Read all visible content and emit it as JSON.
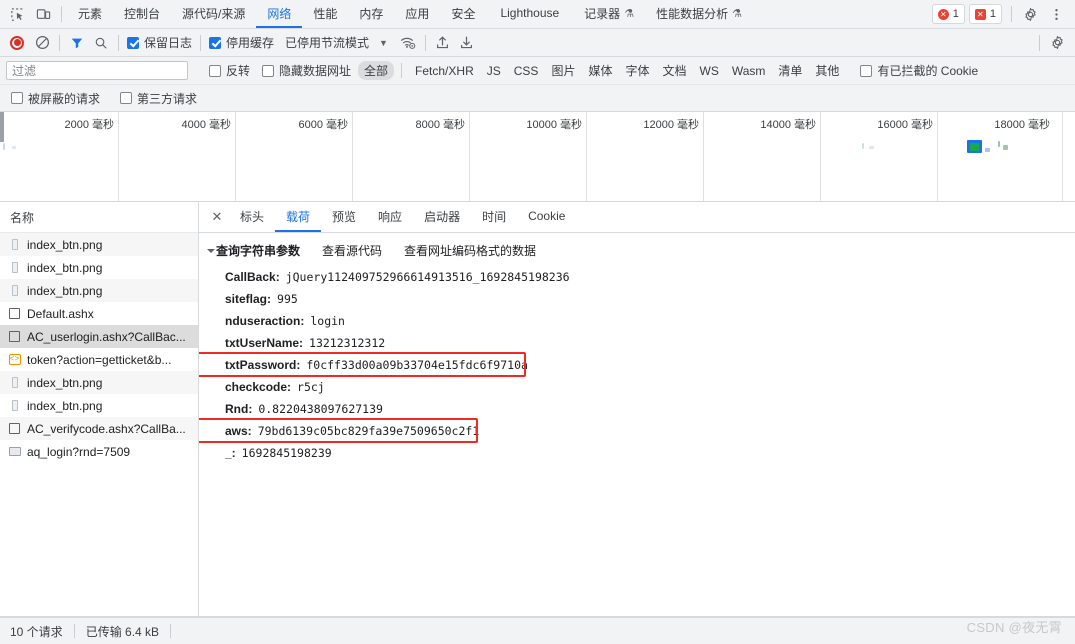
{
  "tabbar": {
    "inspect_icon": "inspect-element-icon",
    "device_icon": "device-toolbar-icon",
    "tabs": [
      {
        "label": "元素",
        "active": false,
        "flask": false
      },
      {
        "label": "控制台",
        "active": false,
        "flask": false
      },
      {
        "label": "源代码/来源",
        "active": false,
        "flask": false
      },
      {
        "label": "网络",
        "active": true,
        "flask": false
      },
      {
        "label": "性能",
        "active": false,
        "flask": false
      },
      {
        "label": "内存",
        "active": false,
        "flask": false
      },
      {
        "label": "应用",
        "active": false,
        "flask": false
      },
      {
        "label": "安全",
        "active": false,
        "flask": false
      },
      {
        "label": "Lighthouse",
        "active": false,
        "flask": false
      },
      {
        "label": "记录器",
        "active": false,
        "flask": true
      },
      {
        "label": "性能数据分析",
        "active": false,
        "flask": true
      }
    ],
    "error_count": "1",
    "warning_count": "1",
    "settings_icon": "gear-icon",
    "more_icon": "more-vertical-icon"
  },
  "netbar": {
    "record_icon": "record-stop-icon",
    "clear_icon": "clear-network-icon",
    "filter_icon": "filter-funnel-icon",
    "search_icon": "search-icon",
    "preserve_log": {
      "label": "保留日志",
      "checked": true
    },
    "disable_cache": {
      "label": "停用缓存",
      "checked": true
    },
    "throttle_label": "已停用节流模式",
    "caret_icon": "chevron-down-icon",
    "wifi_icon": "network-conditions-icon",
    "import_icon": "import-har-icon",
    "export_icon": "export-har-icon",
    "settings_icon": "network-settings-gear-icon"
  },
  "filterbar": {
    "placeholder": "过滤",
    "value": "",
    "invert": {
      "label": "反转",
      "checked": false
    },
    "hide_data_urls": {
      "label": "隐藏数据网址",
      "checked": false
    },
    "types": [
      "全部",
      "Fetch/XHR",
      "JS",
      "CSS",
      "图片",
      "媒体",
      "字体",
      "文档",
      "WS",
      "Wasm",
      "清单",
      "其他"
    ],
    "selected_type": "全部",
    "blocked_cookies": {
      "label": "有已拦截的 Cookie",
      "checked": false
    }
  },
  "filterbar2": {
    "blocked_requests": {
      "label": "被屏蔽的请求",
      "checked": false
    },
    "third_party": {
      "label": "第三方请求",
      "checked": false
    }
  },
  "overview": {
    "ticks": [
      "2000 毫秒",
      "4000 毫秒",
      "6000 毫秒",
      "8000 毫秒",
      "10000 毫秒",
      "12000 毫秒",
      "14000 毫秒",
      "16000 毫秒",
      "18000 毫秒"
    ]
  },
  "sidebar": {
    "header": "名称",
    "rows": [
      {
        "label": "index_btn.png",
        "icon": "image-file-icon",
        "selected": false
      },
      {
        "label": "index_btn.png",
        "icon": "image-file-icon",
        "selected": false
      },
      {
        "label": "index_btn.png",
        "icon": "image-file-icon",
        "selected": false
      },
      {
        "label": "Default.ashx",
        "icon": "document-file-icon",
        "selected": false
      },
      {
        "label": "AC_userlogin.ashx?CallBac...",
        "icon": "document-file-icon",
        "selected": true
      },
      {
        "label": "token?action=getticket&b...",
        "icon": "script-file-icon",
        "selected": false
      },
      {
        "label": "index_btn.png",
        "icon": "image-file-icon",
        "selected": false
      },
      {
        "label": "index_btn.png",
        "icon": "image-file-icon",
        "selected": false
      },
      {
        "label": "AC_verifycode.ashx?CallBa...",
        "icon": "document-file-icon",
        "selected": false
      },
      {
        "label": "aq_login?rnd=7509",
        "icon": "other-file-icon",
        "selected": false
      }
    ]
  },
  "details": {
    "close_icon": "close-icon",
    "tabs": [
      {
        "label": "标头",
        "active": false
      },
      {
        "label": "载荷",
        "active": true
      },
      {
        "label": "预览",
        "active": false
      },
      {
        "label": "响应",
        "active": false
      },
      {
        "label": "启动器",
        "active": false
      },
      {
        "label": "时间",
        "active": false
      },
      {
        "label": "Cookie",
        "active": false
      }
    ],
    "section_title": "查询字符串参数",
    "view_source_link": "查看源代码",
    "view_urlencoded_link": "查看网址编码格式的数据",
    "params": [
      {
        "key": "CallBack:",
        "value": "jQuery112409752966614913516_1692845198236",
        "highlight": false
      },
      {
        "key": "siteflag:",
        "value": "995",
        "highlight": false
      },
      {
        "key": "nduseraction:",
        "value": "login",
        "highlight": false
      },
      {
        "key": "txtUserName:",
        "value": "13212312312",
        "highlight": false
      },
      {
        "key": "txtPassword:",
        "value": "f0cff33d00a09b33704e15fdc6f9710a",
        "highlight": true
      },
      {
        "key": "checkcode:",
        "value": "r5cj",
        "highlight": false
      },
      {
        "key": "Rnd:",
        "value": "0.8220438097627139",
        "highlight": false
      },
      {
        "key": "aws:",
        "value": "79bd6139c05bc829fa39e7509650c2f1",
        "highlight": true
      },
      {
        "key": "_:",
        "value": "1692845198239",
        "highlight": false
      }
    ]
  },
  "statusbar": {
    "requests": "10 个请求",
    "transferred": "已传输 6.4 kB"
  },
  "watermark": "CSDN @夜无霄",
  "colors": {
    "accent": "#1a73e8",
    "highlight_box": "#ee2a23",
    "error_red": "#ea4335",
    "chrome_bg": "#f1f3f4"
  }
}
